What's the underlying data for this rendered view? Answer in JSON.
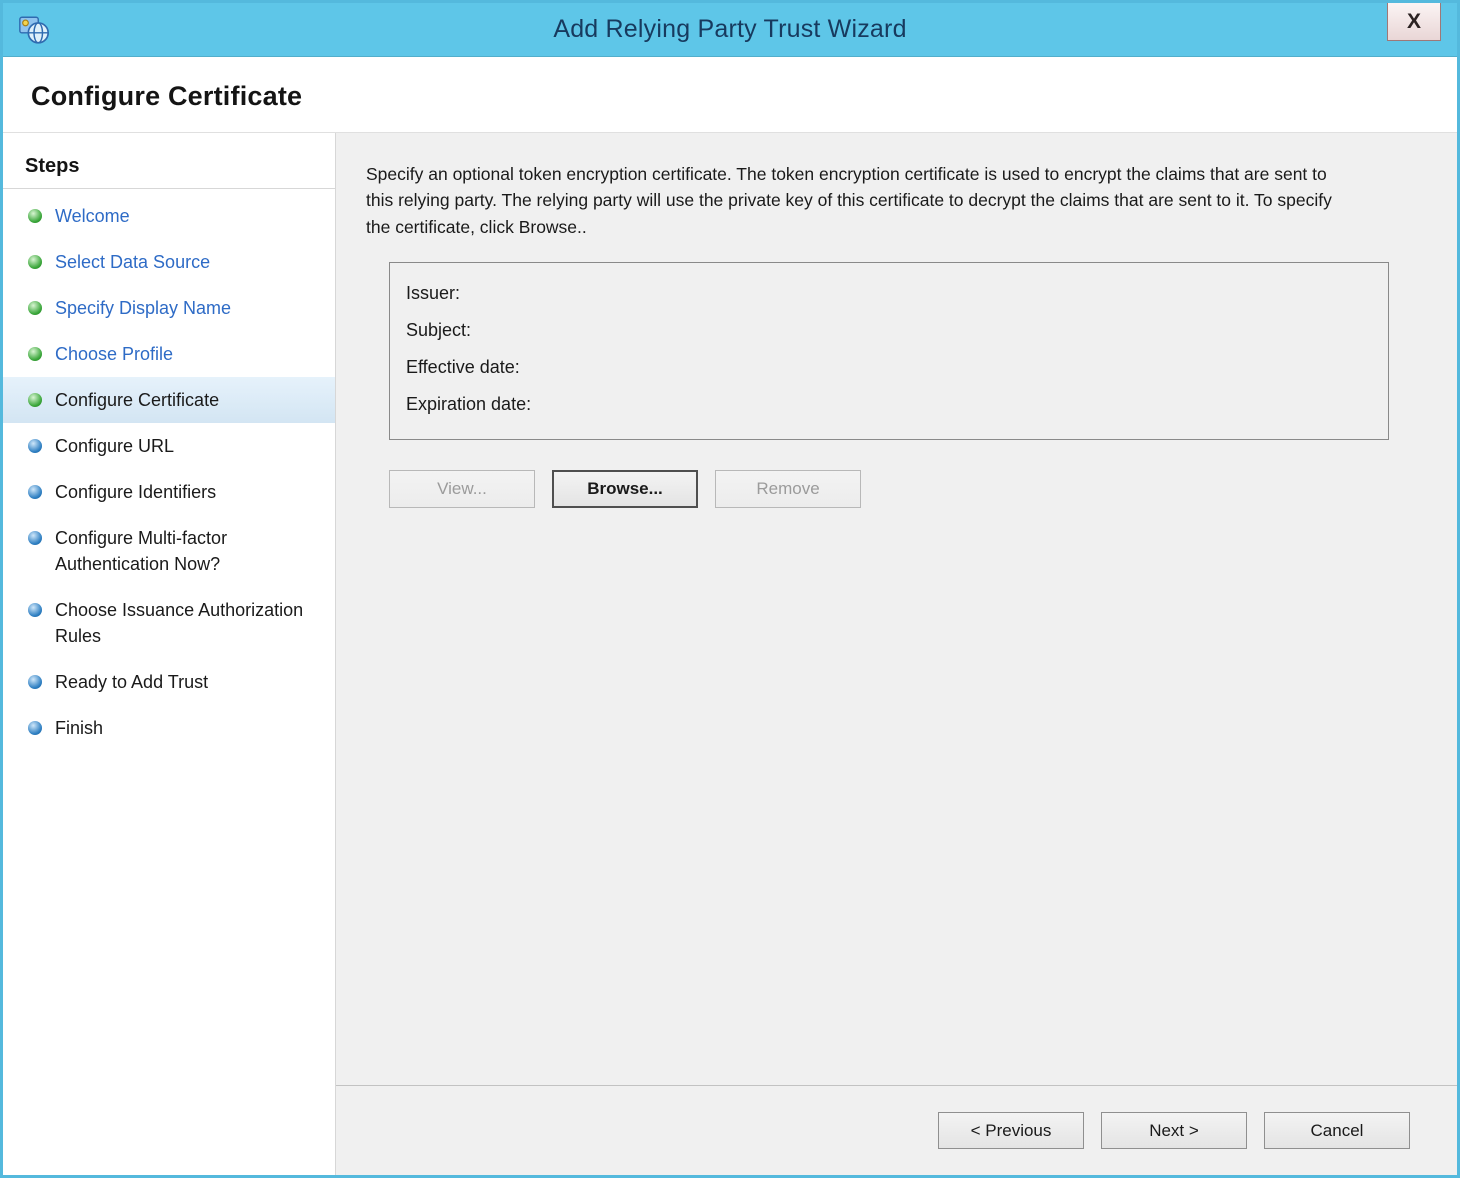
{
  "window": {
    "title": "Add Relying Party Trust Wizard",
    "close_label": "X"
  },
  "header": {
    "title": "Configure Certificate"
  },
  "sidebar": {
    "heading": "Steps",
    "items": [
      {
        "label": "Welcome",
        "dot": "green",
        "link": true,
        "active": false
      },
      {
        "label": "Select Data Source",
        "dot": "green",
        "link": true,
        "active": false
      },
      {
        "label": "Specify Display Name",
        "dot": "green",
        "link": true,
        "active": false
      },
      {
        "label": "Choose Profile",
        "dot": "green",
        "link": true,
        "active": false
      },
      {
        "label": "Configure Certificate",
        "dot": "green",
        "link": false,
        "active": true
      },
      {
        "label": "Configure URL",
        "dot": "blue",
        "link": false,
        "active": false
      },
      {
        "label": "Configure Identifiers",
        "dot": "blue",
        "link": false,
        "active": false
      },
      {
        "label": "Configure Multi-factor Authentication Now?",
        "dot": "blue",
        "link": false,
        "active": false
      },
      {
        "label": "Choose Issuance Authorization Rules",
        "dot": "blue",
        "link": false,
        "active": false
      },
      {
        "label": "Ready to Add Trust",
        "dot": "blue",
        "link": false,
        "active": false
      },
      {
        "label": "Finish",
        "dot": "blue",
        "link": false,
        "active": false
      }
    ]
  },
  "content": {
    "description": "Specify an optional token encryption certificate.  The token encryption certificate is used to encrypt the claims that are sent to this relying party.  The relying party will use the private key of this certificate to decrypt the claims that are sent to it.  To specify the certificate, click Browse..",
    "certificate": {
      "fields": [
        {
          "label": "Issuer:",
          "value": ""
        },
        {
          "label": "Subject:",
          "value": ""
        },
        {
          "label": "Effective date:",
          "value": ""
        },
        {
          "label": "Expiration date:",
          "value": ""
        }
      ]
    },
    "action_buttons": [
      {
        "label": "View...",
        "name": "view-button",
        "enabled": false,
        "focused": false
      },
      {
        "label": "Browse...",
        "name": "browse-button",
        "enabled": true,
        "focused": true
      },
      {
        "label": "Remove",
        "name": "remove-button",
        "enabled": false,
        "focused": false
      }
    ]
  },
  "footer": {
    "buttons": [
      {
        "label": "< Previous",
        "name": "previous-button",
        "enabled": true
      },
      {
        "label": "Next >",
        "name": "next-button",
        "enabled": true
      },
      {
        "label": "Cancel",
        "name": "cancel-button",
        "enabled": true
      }
    ]
  },
  "colors": {
    "frame": "#54b9dd",
    "titlebar": "#5ec6e8",
    "titlebar_text": "#173a5e",
    "link": "#2e6bc6",
    "dot_green": "#3aa63a",
    "dot_blue": "#2e7fc2",
    "active_bg": "#d3e5f3",
    "content_bg": "#f0f0f0",
    "sidebar_bg": "#ffffff"
  }
}
